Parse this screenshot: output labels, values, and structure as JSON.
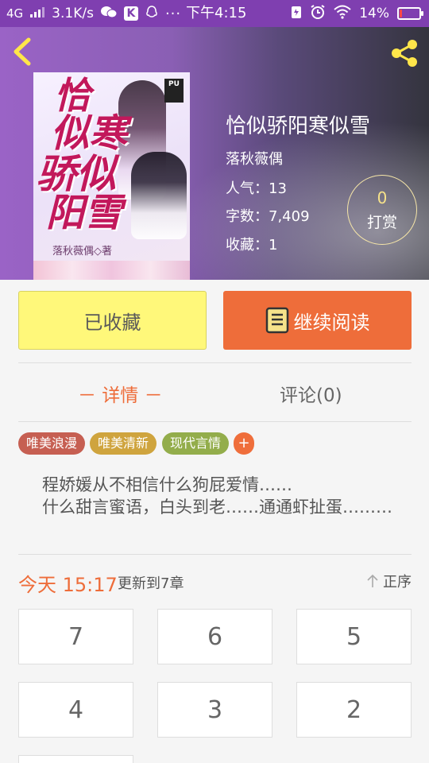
{
  "status_bar": {
    "network": "4G",
    "speed": "3.1K/s",
    "time": "下午4:15",
    "battery_percent": "14%",
    "battery_level": 0.14
  },
  "book": {
    "title": "恰似骄阳寒似雪",
    "author": "落秋薇偶",
    "popularity": "人气：13",
    "word_count": "字数：7,409",
    "favorites": "收藏：1",
    "reward_count": "0",
    "reward_label": "打赏",
    "cover": {
      "title_lines": [
        "恰",
        "似寒",
        "骄似",
        "阳雪"
      ],
      "author_text": "落秋薇偶◇著",
      "badge": "PU"
    }
  },
  "actions": {
    "collected_label": "已收藏",
    "read_label": "继续阅读"
  },
  "tabs": {
    "detail": "－ 详情 －",
    "comments": "评论(0)"
  },
  "tags": [
    "唯美浪漫",
    "唯美清新",
    "现代言情"
  ],
  "tag_add": "+",
  "synopsis": {
    "para1": "程娇媛从不相信什么狗屁爱情……",
    "para2": "什么甜言蜜语，白头到老……通通虾扯蛋………"
  },
  "update": {
    "time": "今天 15:17",
    "to": "更新到7章",
    "sort_label": "正序"
  },
  "chapters": [
    "7",
    "6",
    "5",
    "4",
    "3",
    "2"
  ],
  "colors": {
    "accent": "#ee6d3a",
    "collected_bg": "#fff87a",
    "status_bar": "#7f3fb0"
  }
}
